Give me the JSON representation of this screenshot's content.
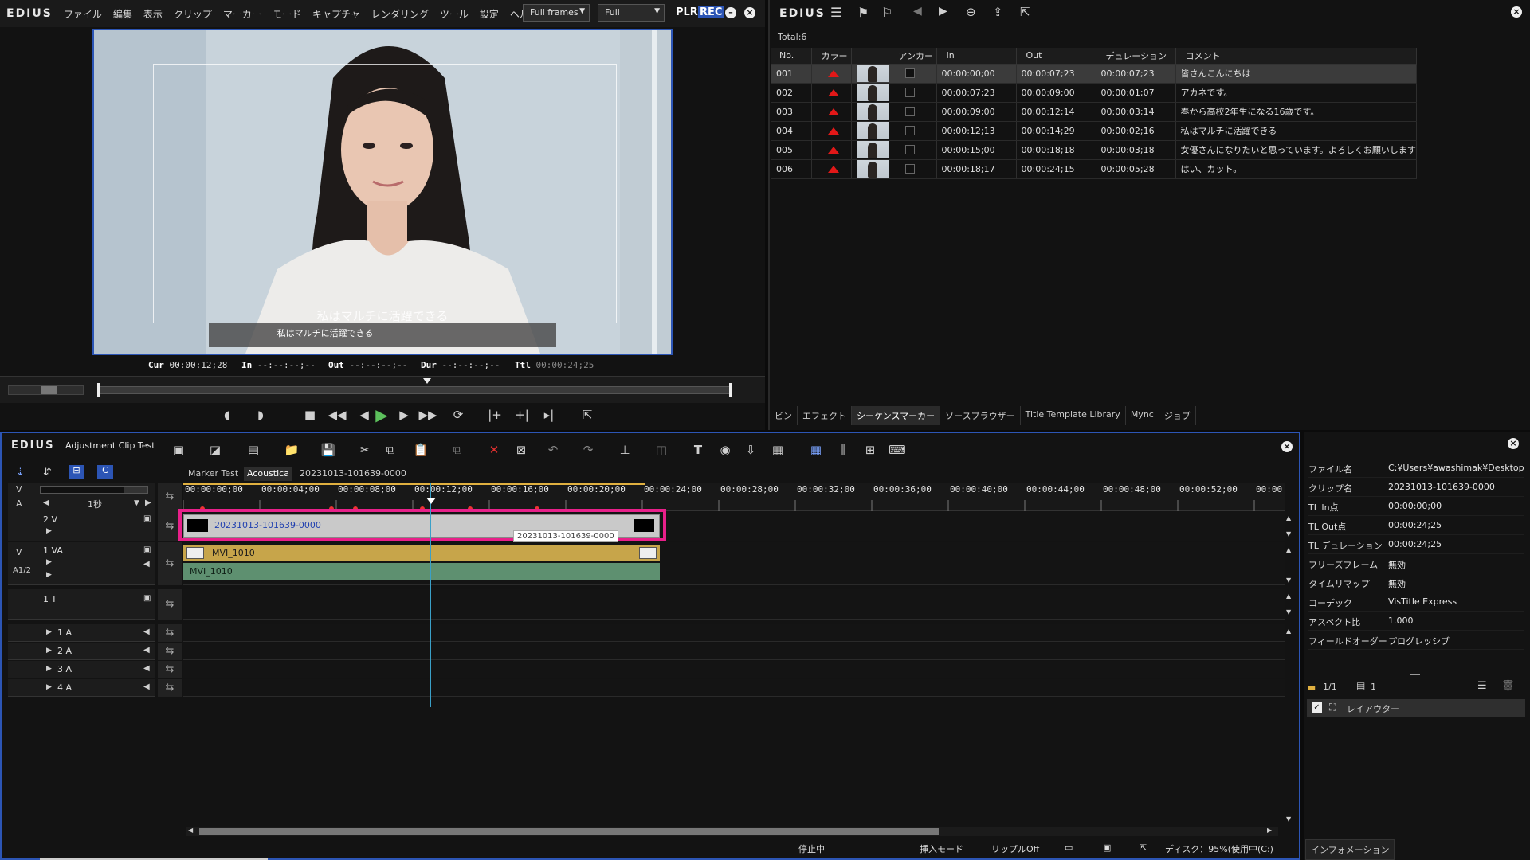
{
  "player": {
    "logo": "EDIUS",
    "menu": [
      "ファイル",
      "編集",
      "表示",
      "クリップ",
      "マーカー",
      "モード",
      "キャプチャ",
      "レンダリング",
      "ツール",
      "設定",
      "ヘルプ"
    ],
    "frames_dropdown": "Full frames",
    "quality_dropdown": "Full",
    "plr_label": "PLR",
    "rec_label": "REC",
    "subtitle_overlay_1": "私はマルチに活躍できる",
    "subtitle_overlay_2": "私はマルチに活躍できる",
    "timecodes": {
      "cur_label": "Cur",
      "cur": "00:00:12;28",
      "in_label": "In",
      "in": "--:--:--;--",
      "out_label": "Out",
      "out": "--:--:--;--",
      "dur_label": "Dur",
      "dur": "--:--:--;--",
      "ttl_label": "Ttl",
      "ttl": "00:00:24;25"
    }
  },
  "marker_panel": {
    "logo": "EDIUS",
    "total": "Total:6",
    "columns": [
      "No.",
      "カラー",
      "",
      "アンカー",
      "In",
      "Out",
      "デュレーション",
      "コメント"
    ],
    "rows": [
      {
        "no": "001",
        "in": "00:00:00;00",
        "out": "00:00:07;23",
        "dur": "00:00:07;23",
        "comment": "皆さんこんにちは",
        "selected": true
      },
      {
        "no": "002",
        "in": "00:00:07;23",
        "out": "00:00:09;00",
        "dur": "00:00:01;07",
        "comment": "アカネです。",
        "selected": false
      },
      {
        "no": "003",
        "in": "00:00:09;00",
        "out": "00:00:12;14",
        "dur": "00:00:03;14",
        "comment": "春から高校2年生になる16歳です。",
        "selected": false
      },
      {
        "no": "004",
        "in": "00:00:12;13",
        "out": "00:00:14;29",
        "dur": "00:00:02;16",
        "comment": "私はマルチに活躍できる",
        "selected": false
      },
      {
        "no": "005",
        "in": "00:00:15;00",
        "out": "00:00:18;18",
        "dur": "00:00:03;18",
        "comment": "女優さんになりたいと思っています。よろしくお願いします",
        "selected": false
      },
      {
        "no": "006",
        "in": "00:00:18;17",
        "out": "00:00:24;15",
        "dur": "00:00:05;28",
        "comment": "はい、カット。",
        "selected": false
      }
    ],
    "tabs": [
      "ビン",
      "エフェクト",
      "シーケンスマーカー",
      "ソースブラウザー",
      "Title Template Library",
      "Mync",
      "ジョブ"
    ],
    "active_tab": 2
  },
  "timeline": {
    "logo": "EDIUS",
    "project_name": "Adjustment Clip Test",
    "sequence_tabs": [
      "Marker Test",
      "Acoustica",
      "20231013-101639-0000"
    ],
    "active_sequence_tab": 1,
    "scale_label": "1秒",
    "ruler": [
      "00:00:00;00",
      "00:00:04;00",
      "00:00:08;00",
      "00:00:12;00",
      "00:00:16;00",
      "00:00:20;00",
      "00:00:24;00",
      "00:00:28;00",
      "00:00:32;00",
      "00:00:36;00",
      "00:00:40;00",
      "00:00:44;00",
      "00:00:48;00",
      "00:00:52;00",
      "00:00"
    ],
    "tracks": {
      "v_label": "V",
      "a_label": "A",
      "t2v": "2 V",
      "t1va": "1 VA",
      "t1va_v": "V",
      "t1va_a": "A1/2",
      "t1t": "1 T",
      "a1": "1 A",
      "a2": "2 A",
      "a3": "3 A",
      "a4": "4 A"
    },
    "clips": {
      "title_clip": "20231013-101639-0000",
      "title_tooltip": "20231013-101639-0000",
      "video_clip": "MVI_1010",
      "audio_clip": "MVI_1010"
    },
    "highlight_color": "#e8208a"
  },
  "info_panel": {
    "rows": [
      {
        "k": "ファイル名",
        "v": "C:¥Users¥awashimak¥Desktop¥..."
      },
      {
        "k": "クリップ名",
        "v": "20231013-101639-0000"
      },
      {
        "k": "TL In点",
        "v": "00:00:00;00"
      },
      {
        "k": "TL Out点",
        "v": "00:00:24;25"
      },
      {
        "k": "TL デュレーション",
        "v": "00:00:24;25"
      },
      {
        "k": "フリーズフレーム",
        "v": "無効"
      },
      {
        "k": "タイムリマップ",
        "v": "無効"
      },
      {
        "k": "コーデック",
        "v": "VisTitle Express"
      },
      {
        "k": "アスペクト比",
        "v": "1.000"
      },
      {
        "k": "フィールドオーダー",
        "v": "プログレッシブ"
      }
    ],
    "page": "1/1",
    "count": "1",
    "filter_label": "レイアウター",
    "tab": "インフォメーション"
  },
  "status_bar": {
    "state": "停止中",
    "mode": "挿入モード",
    "ripple": "リップルOff",
    "disk": "ディスク：95%(使用中(C:)"
  }
}
